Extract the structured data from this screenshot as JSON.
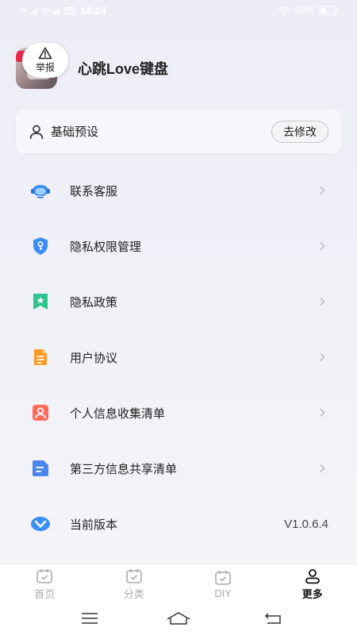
{
  "status_bar": {
    "signal1": "4G",
    "signal2": "5G",
    "hd": "HD",
    "time": "14:24",
    "battery": "40%",
    "battery_level": 0.4
  },
  "profile": {
    "report_label": "举报",
    "app_name": "心跳Love键盘"
  },
  "preset": {
    "label": "基础预设",
    "button": "去修改"
  },
  "menu": {
    "items": [
      {
        "label": "联系客服",
        "icon": "customer-service-icon"
      },
      {
        "label": "隐私权限管理",
        "icon": "privacy-shield-icon"
      },
      {
        "label": "隐私政策",
        "icon": "policy-bookmark-icon"
      },
      {
        "label": "用户协议",
        "icon": "agreement-doc-icon"
      },
      {
        "label": "个人信息收集清单",
        "icon": "personal-info-icon"
      },
      {
        "label": "第三方信息共享清单",
        "icon": "third-party-doc-icon"
      },
      {
        "label": "当前版本",
        "icon": "version-icon"
      }
    ],
    "version_value": "V1.0.6.4"
  },
  "nav": {
    "tabs": [
      {
        "label": "首页",
        "icon": "home-calendar-icon"
      },
      {
        "label": "分类",
        "icon": "category-calendar-icon"
      },
      {
        "label": "DIY",
        "icon": "diy-calendar-icon"
      },
      {
        "label": "更多",
        "icon": "more-user-icon"
      }
    ],
    "active_index": 3
  },
  "colors": {
    "accent_blue": "#3a8ef5",
    "green": "#2fc58c",
    "orange": "#ff9a2a",
    "red": "#ff6b5b",
    "blue_doc": "#4b86f0"
  }
}
